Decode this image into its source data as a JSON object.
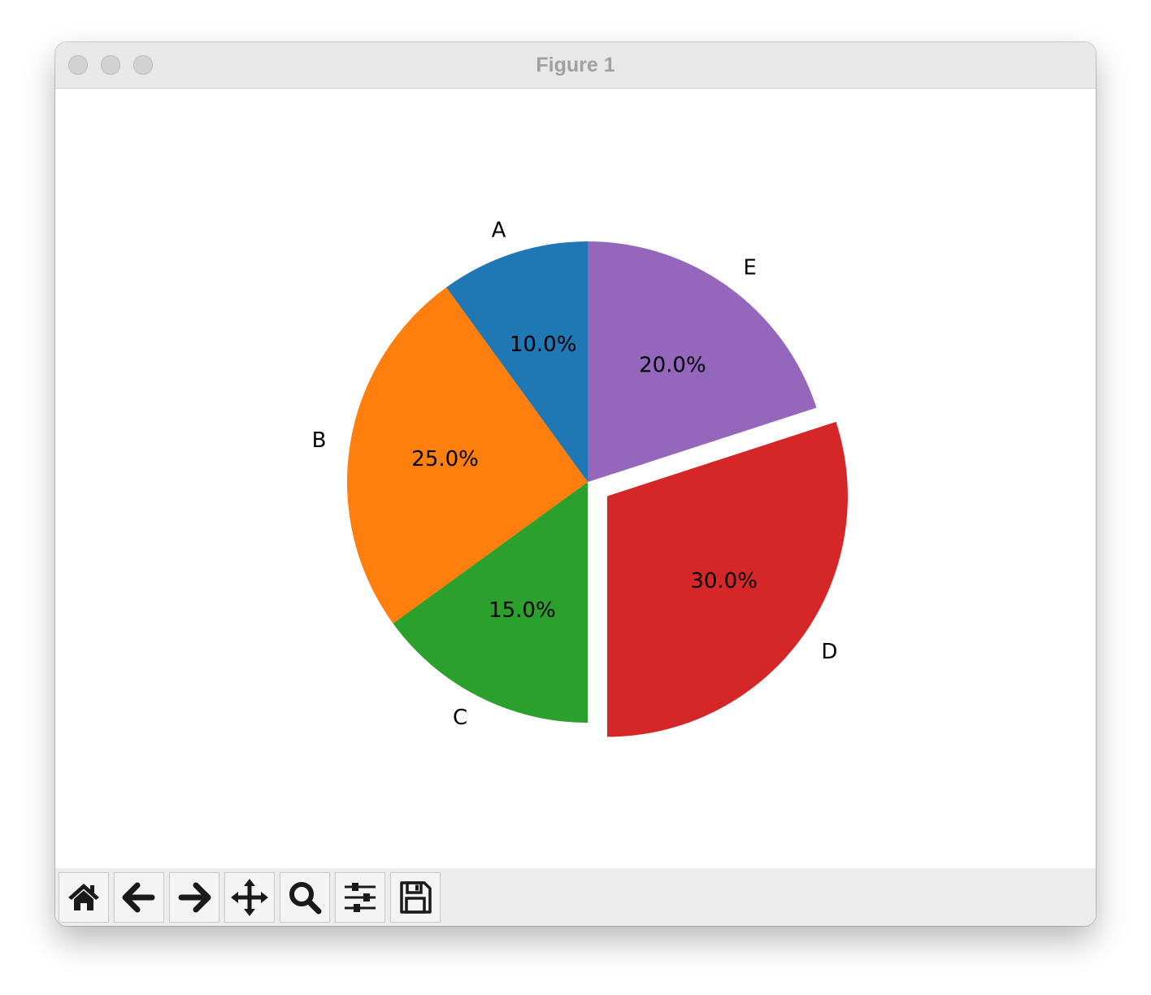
{
  "window": {
    "title": "Figure 1"
  },
  "toolbar": {
    "buttons": [
      {
        "name": "home-button",
        "icon": "home-icon"
      },
      {
        "name": "back-button",
        "icon": "arrow-left-icon"
      },
      {
        "name": "forward-button",
        "icon": "arrow-right-icon"
      },
      {
        "name": "pan-button",
        "icon": "move-icon"
      },
      {
        "name": "zoom-button",
        "icon": "magnifier-icon"
      },
      {
        "name": "configure-subplots-button",
        "icon": "sliders-icon"
      },
      {
        "name": "save-button",
        "icon": "floppy-disk-icon"
      }
    ]
  },
  "chart_data": {
    "type": "pie",
    "title": "",
    "start_angle_deg": 90,
    "direction": "counterclockwise",
    "slices": [
      {
        "label": "A",
        "value": 10,
        "pct_label": "10.0%",
        "color": "#1f77b4",
        "explode": 0
      },
      {
        "label": "B",
        "value": 25,
        "pct_label": "25.0%",
        "color": "#ff7f0e",
        "explode": 0
      },
      {
        "label": "C",
        "value": 15,
        "pct_label": "15.0%",
        "color": "#2ca02c",
        "explode": 0
      },
      {
        "label": "D",
        "value": 30,
        "pct_label": "30.0%",
        "color": "#d62728",
        "explode": 0.1
      },
      {
        "label": "E",
        "value": 20,
        "pct_label": "20.0%",
        "color": "#9467bd",
        "explode": 0
      }
    ]
  }
}
